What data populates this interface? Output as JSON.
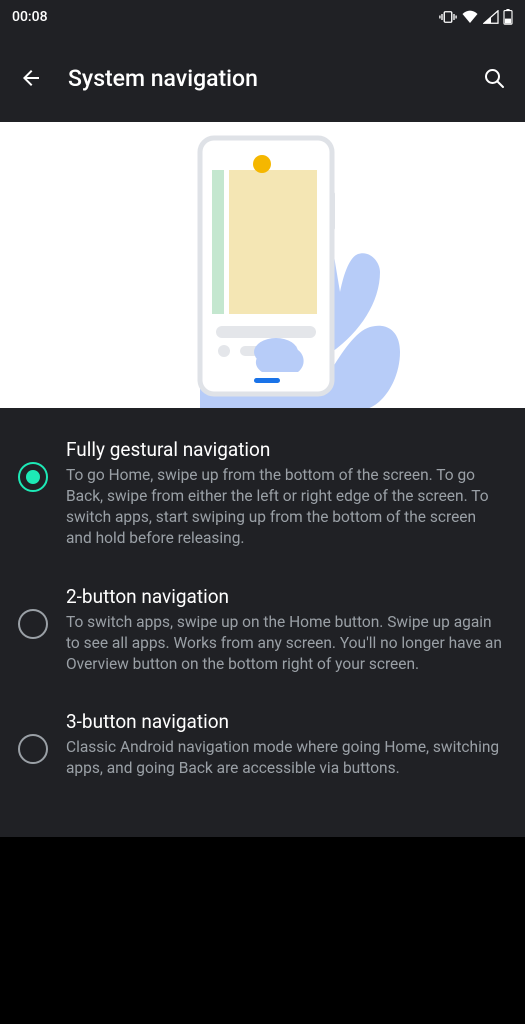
{
  "status": {
    "time": "00:08"
  },
  "appbar": {
    "title": "System navigation"
  },
  "options": [
    {
      "id": "fully-gestural",
      "title": "Fully gestural navigation",
      "desc": "To go Home, swipe up from the bottom of the screen. To go Back, swipe from either the left or right edge of the screen. To switch apps, start swiping up from the bottom of the screen and hold before releasing.",
      "selected": true
    },
    {
      "id": "two-button",
      "title": "2-button navigation",
      "desc": "To switch apps, swipe up on the Home button. Swipe up again to see all apps. Works from any screen. You'll no longer have an Overview button on the bottom right of your screen.",
      "selected": false
    },
    {
      "id": "three-button",
      "title": "3-button navigation",
      "desc": "Classic Android navigation mode where going Home, switching apps, and going Back are accessible via buttons.",
      "selected": false
    }
  ]
}
